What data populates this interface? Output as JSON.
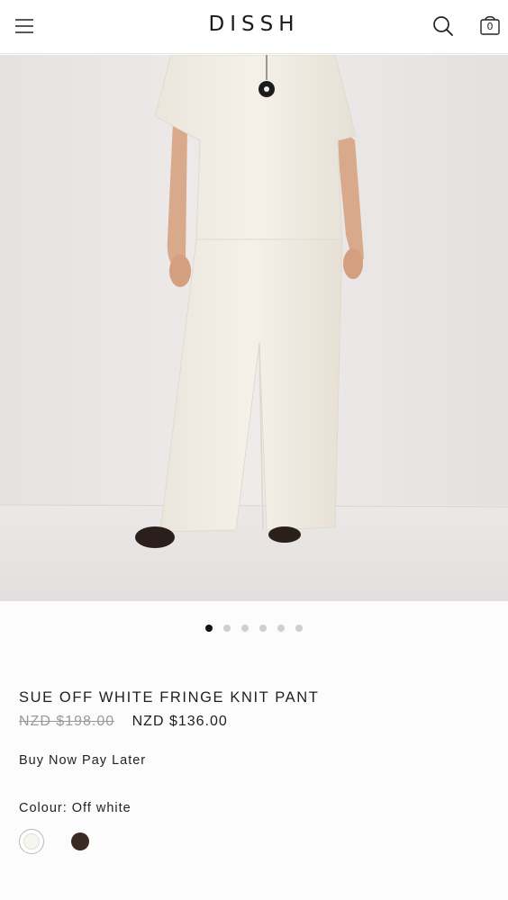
{
  "header": {
    "menu_icon": "hamburger-menu-icon",
    "logo": "DISSH",
    "search_icon": "search-icon",
    "bag_icon": "shopping-bag-icon",
    "bag_count": "0"
  },
  "hero": {
    "image_subject": "model-in-off-white-knit-top-and-fringe-knit-pant",
    "dots_total": 6,
    "dots_active": 1
  },
  "product": {
    "title": "SUE OFF WHITE FRINGE KNIT PANT",
    "price_original": "NZD $198.00",
    "price_sale": "NZD $136.00",
    "bnpl_label": "Buy Now Pay Later",
    "colour_label": "Colour: Off white",
    "swatches": [
      {
        "name": "Off white",
        "color": "#f7f5f0",
        "selected": true
      },
      {
        "name": "Brown",
        "color": "#3a2a22",
        "selected": false
      }
    ]
  },
  "colors": {
    "background": "#fdfcfc",
    "text": "#1f1f1f",
    "strike_price": "#9a9a9a",
    "dot_active": "#111111",
    "dot_inactive": "#cfcfcf"
  }
}
